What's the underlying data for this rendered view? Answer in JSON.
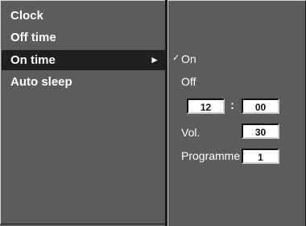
{
  "menu": {
    "items": [
      {
        "label": "Clock"
      },
      {
        "label": "Off time"
      },
      {
        "label": "On time",
        "arrow": "►"
      },
      {
        "label": "Auto sleep"
      }
    ]
  },
  "submenu": {
    "check_mark": "✓",
    "on_label": "On",
    "off_label": "Off",
    "hour": "12",
    "colon": ":",
    "minute": "00",
    "volume_label": "Vol.",
    "volume_value": "30",
    "programme_label": "Programme",
    "programme_value": "1"
  }
}
